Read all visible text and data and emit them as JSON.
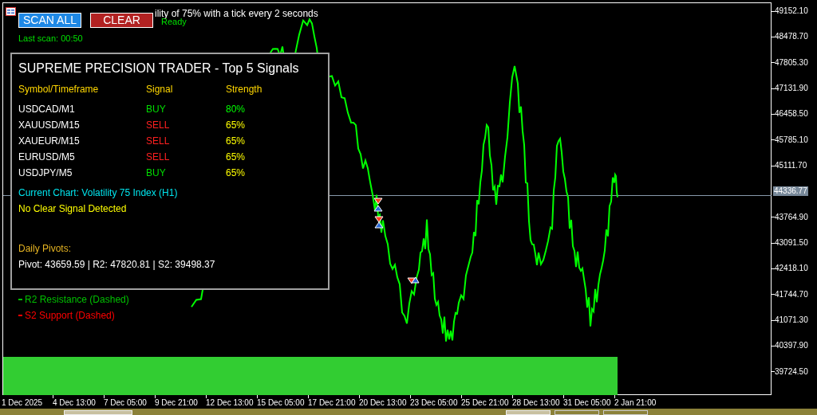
{
  "window": {
    "title_visible": "ility of 75% with a tick every 2 seconds"
  },
  "toolbar": {
    "buttons": [
      {
        "label": "SCAN ALL",
        "kind": "scan"
      },
      {
        "label": "CLEAR",
        "kind": "clear"
      }
    ],
    "status": "Ready",
    "last_scan": "Last scan: 00:50"
  },
  "panel": {
    "title": "SUPREME PRECISION TRADER - Top 5 Signals",
    "columns": [
      "Symbol/Timeframe",
      "Signal",
      "Strength"
    ],
    "rows": [
      {
        "symbol": "USDCAD/M1",
        "signal": {
          "text": "BUY",
          "kind": "buy"
        },
        "strength": {
          "text": "80%",
          "color": "#00ff00"
        }
      },
      {
        "symbol": "XAUUSD/M15",
        "signal": {
          "text": "SELL",
          "kind": "sell"
        },
        "strength": {
          "text": "65%",
          "color": "#ffff00"
        }
      },
      {
        "symbol": "XAUEUR/M15",
        "signal": {
          "text": "SELL",
          "kind": "sell"
        },
        "strength": {
          "text": "65%",
          "color": "#ffff00"
        }
      },
      {
        "symbol": "EURUSD/M5",
        "signal": {
          "text": "SELL",
          "kind": "sell"
        },
        "strength": {
          "text": "65%",
          "color": "#ffff00"
        }
      },
      {
        "symbol": "USDJPY/M5",
        "signal": {
          "text": "BUY",
          "kind": "buy"
        },
        "strength": {
          "text": "65%",
          "color": "#ffff00"
        }
      }
    ],
    "current_chart": "Current Chart: Volatility 75 Index (H1)",
    "verdict": "No Clear Signal Detected",
    "pivots_heading": "Daily Pivots:",
    "pivots": "Pivot: 43659.59 | R2: 47820.81 | S2: 39498.37"
  },
  "legend": [
    {
      "text": "R2 Resistance (Dashed)",
      "color": "#00c000"
    },
    {
      "text": "S2 Support (Dashed)",
      "color": "#ff0000"
    }
  ],
  "price_axis": [
    {
      "text": "49152.10",
      "kind": "tick"
    },
    {
      "text": "48478.70",
      "kind": "tick"
    },
    {
      "text": "47805.30",
      "kind": "tick"
    },
    {
      "text": "47131.90",
      "kind": "tick"
    },
    {
      "text": "46458.50",
      "kind": "tick"
    },
    {
      "text": "45785.10",
      "kind": "tick"
    },
    {
      "text": "45111.70",
      "kind": "tick"
    },
    {
      "text": "44336.77",
      "kind": "current"
    },
    {
      "text": "43764.90",
      "kind": "tick"
    },
    {
      "text": "43091.50",
      "kind": "tick"
    },
    {
      "text": "42418.10",
      "kind": "tick"
    },
    {
      "text": "41744.70",
      "kind": "tick"
    },
    {
      "text": "41071.30",
      "kind": "tick"
    },
    {
      "text": "40397.90",
      "kind": "tick"
    },
    {
      "text": "39724.50",
      "kind": "tick"
    }
  ],
  "time_axis": [
    "1 Dec 2025",
    "4 Dec 13:00",
    "7 Dec 05:00",
    "9 Dec 21:00",
    "12 Dec 13:00",
    "15 Dec 05:00",
    "17 Dec 21:00",
    "20 Dec 13:00",
    "23 Dec 05:00",
    "25 Dec 21:00",
    "28 Dec 13:00",
    "31 Dec 05:00",
    "2 Jan 21:00"
  ]
}
